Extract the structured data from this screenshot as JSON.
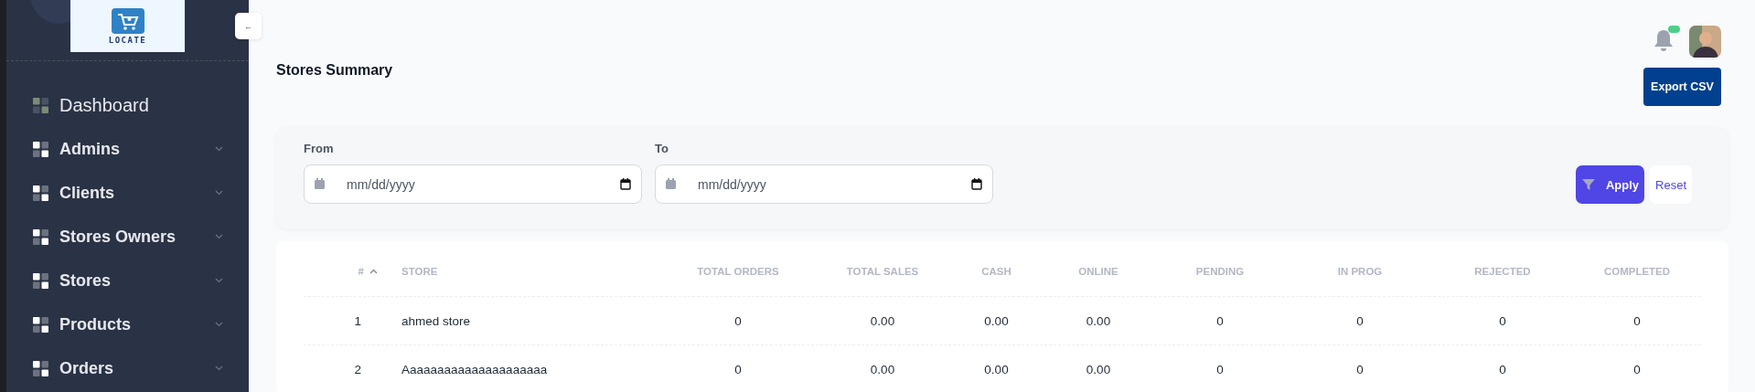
{
  "sidebar": {
    "logo_text": "LOCATE",
    "items": [
      {
        "label": "Dashboard",
        "kind": "link",
        "selected": true
      },
      {
        "label": "Admins",
        "kind": "group",
        "selected": false
      },
      {
        "label": "Clients",
        "kind": "group",
        "selected": false
      },
      {
        "label": "Stores Owners",
        "kind": "group",
        "selected": false
      },
      {
        "label": "Stores",
        "kind": "group",
        "selected": false
      },
      {
        "label": "Products",
        "kind": "group",
        "selected": false
      },
      {
        "label": "Orders",
        "kind": "group",
        "selected": false
      }
    ]
  },
  "collapse_button": "←",
  "header": {
    "title": "Stores Summary",
    "notification_dot": true,
    "export_button": "Export CSV"
  },
  "filters": {
    "fields": [
      {
        "label": "From",
        "placeholder": "mm/dd/yyyy"
      },
      {
        "label": "To",
        "placeholder": "mm/dd/yyyy"
      }
    ],
    "apply_button": "Apply",
    "reset_button": "Reset"
  },
  "table": {
    "columns": [
      {
        "label": "#",
        "sorted_ascending": true
      },
      {
        "label": "STORE"
      },
      {
        "label": "TOTAL ORDERS"
      },
      {
        "label": "TOTAL SALES"
      },
      {
        "label": "CASH"
      },
      {
        "label": "ONLINE"
      },
      {
        "label": "PENDING"
      },
      {
        "label": "IN PROG"
      },
      {
        "label": "REJECTED"
      },
      {
        "label": "COMPLETED"
      }
    ],
    "rows": [
      [
        "1",
        "ahmed store",
        "0",
        "0.00",
        "0.00",
        "0.00",
        "0",
        "0",
        "0",
        "0"
      ],
      [
        "2",
        "Aaaaaaaaaaaaaaaaaaaaa",
        "0",
        "0.00",
        "0.00",
        "0.00",
        "0",
        "0",
        "0",
        "0"
      ]
    ]
  }
}
